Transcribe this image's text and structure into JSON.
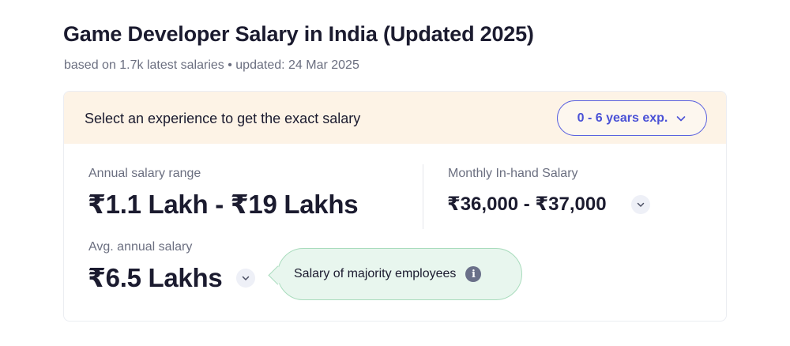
{
  "header": {
    "title": "Game Developer Salary in India (Updated 2025)",
    "subtitle": "based on 1.7k latest salaries • updated: 24 Mar 2025"
  },
  "experience_bar": {
    "prompt": "Select an experience to get the exact salary",
    "selected": "0 - 6 years exp."
  },
  "annual_range": {
    "label": "Annual salary range",
    "value": "₹1.1 Lakh - ₹19 Lakhs"
  },
  "monthly_inhand": {
    "label": "Monthly In-hand Salary",
    "value": "₹36,000 - ₹37,000"
  },
  "avg_annual": {
    "label": "Avg. annual salary",
    "value": "₹6.5 Lakhs"
  },
  "tooltip": {
    "text": "Salary of majority employees",
    "icon": "i"
  },
  "colors": {
    "accent": "#4a51d6",
    "header_bg": "#fdf3e6",
    "tooltip_bg": "#e8f6ee",
    "tooltip_border": "#a9dcbd"
  }
}
